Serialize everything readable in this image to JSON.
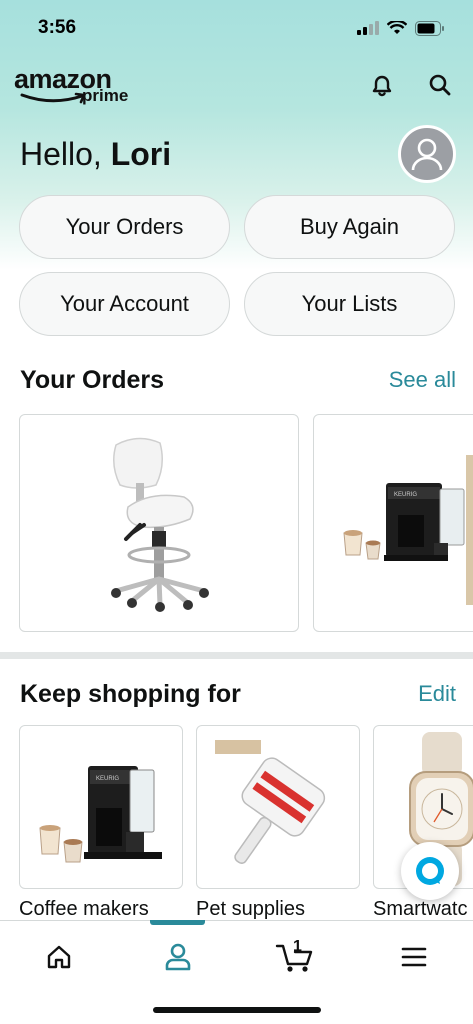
{
  "status_bar": {
    "time": "3:56"
  },
  "header": {
    "logo_word": "amazon",
    "logo_sub": "prime",
    "icons": [
      "bell-icon",
      "search-icon"
    ]
  },
  "greeting": {
    "prefix": "Hello,",
    "name": "Lori"
  },
  "quick_actions": [
    {
      "label": "Your Orders"
    },
    {
      "label": "Buy Again"
    },
    {
      "label": "Your Account"
    },
    {
      "label": "Your Lists"
    }
  ],
  "orders_section": {
    "title": "Your Orders",
    "link": "See all",
    "items": [
      {
        "image": "white-saddle-stool"
      },
      {
        "image": "keurig-coffee-maker"
      }
    ]
  },
  "keep_shopping": {
    "title": "Keep shopping for",
    "link": "Edit",
    "items": [
      {
        "label": "Coffee makers",
        "image": "keurig-coffee-maker"
      },
      {
        "label": "Pet supplies",
        "image": "lint-roller"
      },
      {
        "label": "Smartwatc",
        "image": "apple-watch"
      }
    ]
  },
  "tab_bar": {
    "tabs": [
      "home-icon",
      "account-icon",
      "cart-icon",
      "menu-icon"
    ],
    "active": "account-icon",
    "cart_count": "1"
  },
  "colors": {
    "accent": "#2a8a9a",
    "hero_top": "#a6e0dd",
    "text": "#0f1111"
  }
}
